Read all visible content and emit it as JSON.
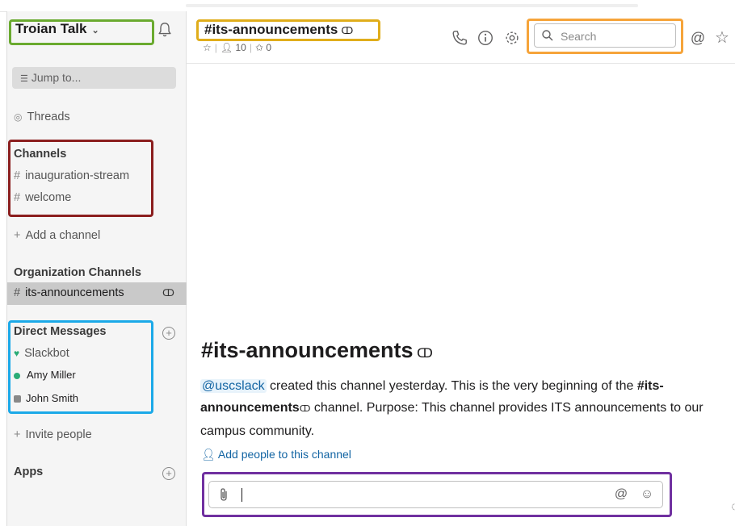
{
  "workspace": {
    "name": "Troian Talk",
    "chevron": "⌄"
  },
  "sidebar": {
    "jump_to": "Jump to...",
    "threads": "Threads",
    "channels_heading": "Channels",
    "channels": [
      "inauguration-stream",
      "welcome"
    ],
    "add_channel": "Add a channel",
    "org_heading": "Organization Channels",
    "org_channels": [
      "its-announcements"
    ],
    "dm_heading": "Direct Messages",
    "direct_messages": [
      "Slackbot",
      "Amy Miller",
      "John Smith"
    ],
    "invite": "Invite people",
    "apps_heading": "Apps"
  },
  "header": {
    "channel": "#its-announcements",
    "star": "☆",
    "members": "10",
    "pins": "0",
    "search_placeholder": "Search"
  },
  "intro": {
    "title": "#its-announcements",
    "mention": "@uscslack",
    "text_1": " created this channel yesterday. This is the very beginning of the ",
    "channel_bold": "#its-announcements",
    "text_2": " channel. Purpose: This channel provides ITS announcements to our campus community.",
    "add_people": "Add people to this channel"
  },
  "composer": {
    "value": ""
  },
  "colors": {
    "accent_link": "#1264a3",
    "presence_green": "#2bac76",
    "box_green": "#6aaa2f",
    "box_yellow": "#e0ad1b",
    "box_orange": "#f6a43a",
    "box_red": "#8b1e1e",
    "box_blue": "#1ba9e8",
    "box_purple": "#7030a0"
  }
}
